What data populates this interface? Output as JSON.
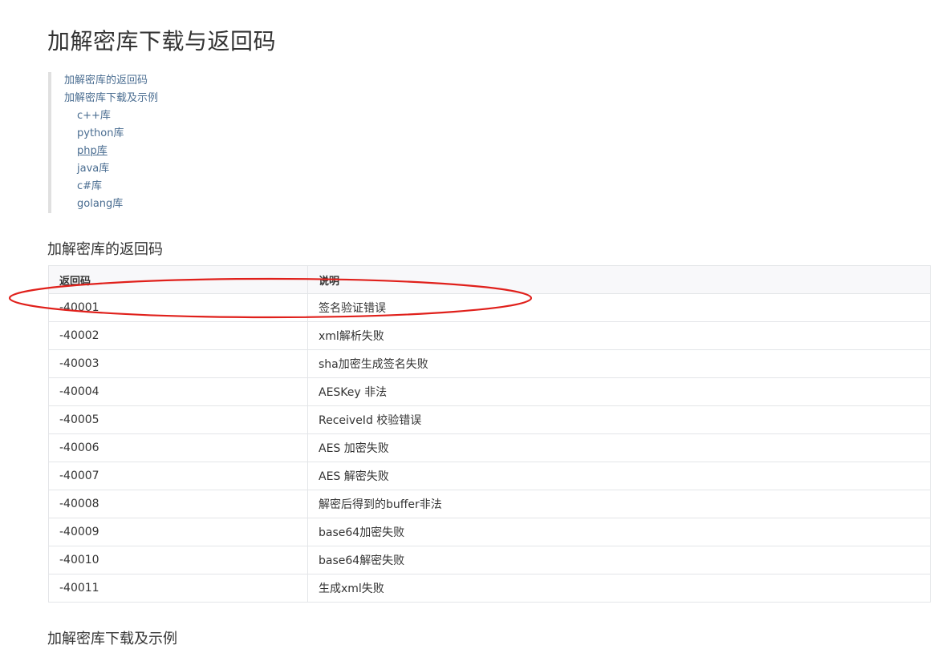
{
  "page": {
    "title": "加解密库下载与返回码"
  },
  "toc": {
    "items": [
      {
        "label": "加解密库的返回码",
        "level": 1
      },
      {
        "label": "加解密库下载及示例",
        "level": 1
      },
      {
        "label": "c++库",
        "level": 2
      },
      {
        "label": "python库",
        "level": 2
      },
      {
        "label": "php库",
        "level": 2
      },
      {
        "label": "java库",
        "level": 2
      },
      {
        "label": "c#库",
        "level": 2
      },
      {
        "label": "golang库",
        "level": 2
      }
    ]
  },
  "section1": {
    "title": "加解密库的返回码"
  },
  "table": {
    "headers": [
      "返回码",
      "说明"
    ],
    "rows": [
      [
        "-40001",
        "签名验证错误"
      ],
      [
        "-40002",
        "xml解析失败"
      ],
      [
        "-40003",
        "sha加密生成签名失败"
      ],
      [
        "-40004",
        "AESKey 非法"
      ],
      [
        "-40005",
        "ReceiveId 校验错误"
      ],
      [
        "-40006",
        "AES 加密失败"
      ],
      [
        "-40007",
        "AES 解密失败"
      ],
      [
        "-40008",
        "解密后得到的buffer非法"
      ],
      [
        "-40009",
        "base64加密失败"
      ],
      [
        "-40010",
        "base64解密失败"
      ],
      [
        "-40011",
        "生成xml失败"
      ]
    ]
  },
  "section2": {
    "title": "加解密库下载及示例"
  },
  "annotation": {
    "color": "#e0201b"
  }
}
